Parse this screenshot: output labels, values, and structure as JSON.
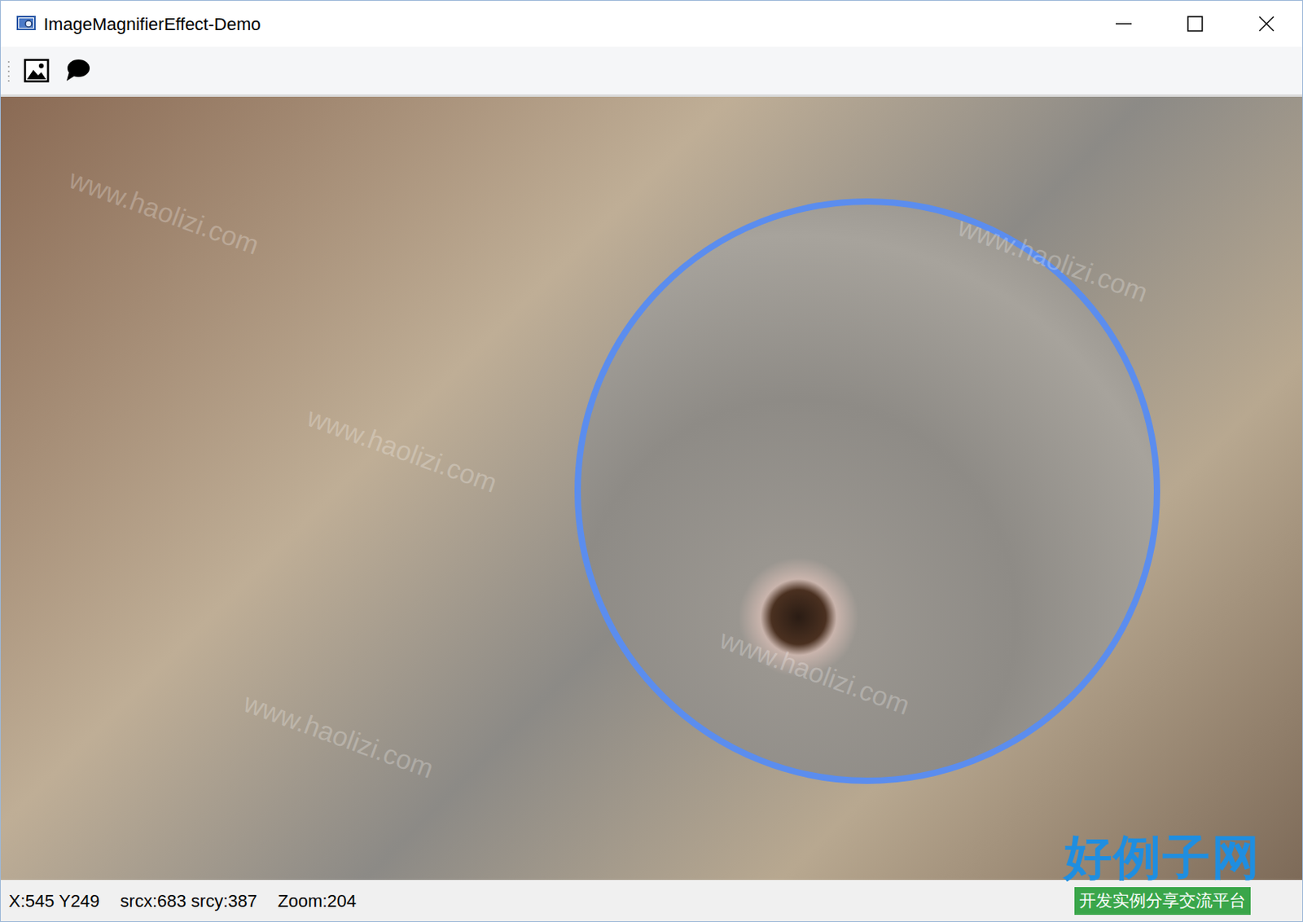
{
  "window": {
    "title": "ImageMagnifierEffect-Demo"
  },
  "status_bar": [
    {
      "text": "X:545 Y249"
    },
    {
      "text": "srcx:683 srcy:387"
    },
    {
      "text": "Zoom:204"
    }
  ],
  "watermark": {
    "text": "www.haolizi.com",
    "logo": "好例子网",
    "slogan": "开发实例分享交流平台"
  }
}
